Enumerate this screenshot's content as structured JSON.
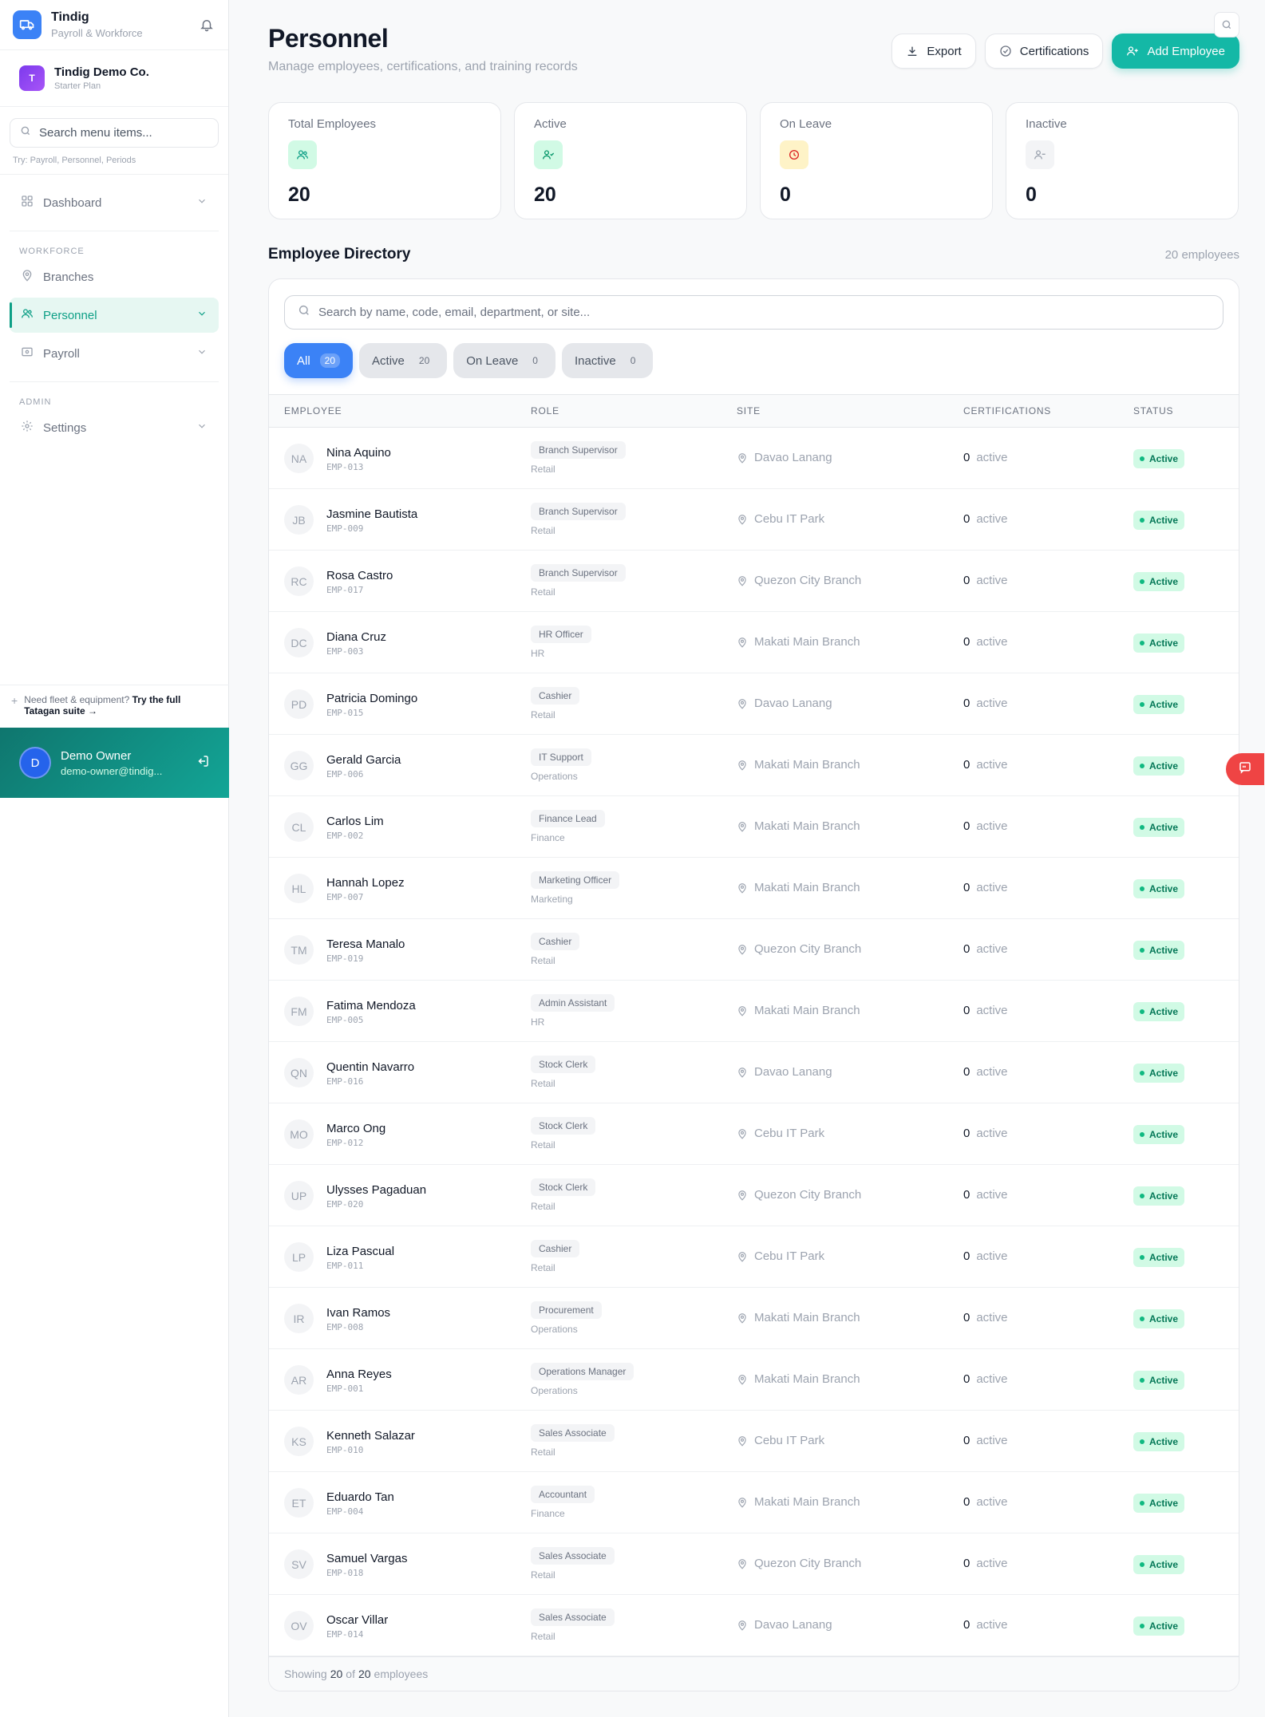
{
  "sidebar": {
    "brand_name": "Tindig",
    "brand_sub": "Payroll & Workforce",
    "org_initial": "T",
    "org_name": "Tindig Demo Co.",
    "org_plan": "Starter Plan",
    "search_placeholder": "Search menu items...",
    "search_hint": "Try: Payroll, Personnel, Periods",
    "dashboard": "Dashboard",
    "workforce_section": "WORKFORCE",
    "branches": "Branches",
    "personnel": "Personnel",
    "payroll": "Payroll",
    "admin_section": "ADMIN",
    "settings": "Settings",
    "promo_text": "Need fleet & equipment?",
    "promo_link": "Try the full Tatagan suite →",
    "user_initial": "D",
    "user_name": "Demo Owner",
    "user_email": "demo-owner@tindig..."
  },
  "header": {
    "title": "Personnel",
    "subtitle": "Manage employees, certifications, and training records",
    "export": "Export",
    "certifications": "Certifications",
    "add_employee": "Add Employee"
  },
  "stats": [
    {
      "label": "Total Employees",
      "value": "20"
    },
    {
      "label": "Active",
      "value": "20"
    },
    {
      "label": "On Leave",
      "value": "0"
    },
    {
      "label": "Inactive",
      "value": "0"
    }
  ],
  "directory": {
    "title": "Employee Directory",
    "count": "20 employees",
    "search_placeholder": "Search by name, code, email, department, or site...",
    "filters": [
      {
        "label": "All",
        "count": "20"
      },
      {
        "label": "Active",
        "count": "20"
      },
      {
        "label": "On Leave",
        "count": "0"
      },
      {
        "label": "Inactive",
        "count": "0"
      }
    ],
    "columns": {
      "employee": "EMPLOYEE",
      "role": "ROLE",
      "site": "SITE",
      "certifications": "CERTIFICATIONS",
      "status": "STATUS"
    },
    "cert_suffix": "active",
    "rows": [
      {
        "initials": "NA",
        "name": "Nina Aquino",
        "code": "EMP-013",
        "role": "Branch Supervisor",
        "dept": "Retail",
        "site": "Davao Lanang",
        "certs": "0",
        "status": "Active"
      },
      {
        "initials": "JB",
        "name": "Jasmine Bautista",
        "code": "EMP-009",
        "role": "Branch Supervisor",
        "dept": "Retail",
        "site": "Cebu IT Park",
        "certs": "0",
        "status": "Active"
      },
      {
        "initials": "RC",
        "name": "Rosa Castro",
        "code": "EMP-017",
        "role": "Branch Supervisor",
        "dept": "Retail",
        "site": "Quezon City Branch",
        "certs": "0",
        "status": "Active"
      },
      {
        "initials": "DC",
        "name": "Diana Cruz",
        "code": "EMP-003",
        "role": "HR Officer",
        "dept": "HR",
        "site": "Makati Main Branch",
        "certs": "0",
        "status": "Active"
      },
      {
        "initials": "PD",
        "name": "Patricia Domingo",
        "code": "EMP-015",
        "role": "Cashier",
        "dept": "Retail",
        "site": "Davao Lanang",
        "certs": "0",
        "status": "Active"
      },
      {
        "initials": "GG",
        "name": "Gerald Garcia",
        "code": "EMP-006",
        "role": "IT Support",
        "dept": "Operations",
        "site": "Makati Main Branch",
        "certs": "0",
        "status": "Active"
      },
      {
        "initials": "CL",
        "name": "Carlos Lim",
        "code": "EMP-002",
        "role": "Finance Lead",
        "dept": "Finance",
        "site": "Makati Main Branch",
        "certs": "0",
        "status": "Active"
      },
      {
        "initials": "HL",
        "name": "Hannah Lopez",
        "code": "EMP-007",
        "role": "Marketing Officer",
        "dept": "Marketing",
        "site": "Makati Main Branch",
        "certs": "0",
        "status": "Active"
      },
      {
        "initials": "TM",
        "name": "Teresa Manalo",
        "code": "EMP-019",
        "role": "Cashier",
        "dept": "Retail",
        "site": "Quezon City Branch",
        "certs": "0",
        "status": "Active"
      },
      {
        "initials": "FM",
        "name": "Fatima Mendoza",
        "code": "EMP-005",
        "role": "Admin Assistant",
        "dept": "HR",
        "site": "Makati Main Branch",
        "certs": "0",
        "status": "Active"
      },
      {
        "initials": "QN",
        "name": "Quentin Navarro",
        "code": "EMP-016",
        "role": "Stock Clerk",
        "dept": "Retail",
        "site": "Davao Lanang",
        "certs": "0",
        "status": "Active"
      },
      {
        "initials": "MO",
        "name": "Marco Ong",
        "code": "EMP-012",
        "role": "Stock Clerk",
        "dept": "Retail",
        "site": "Cebu IT Park",
        "certs": "0",
        "status": "Active"
      },
      {
        "initials": "UP",
        "name": "Ulysses Pagaduan",
        "code": "EMP-020",
        "role": "Stock Clerk",
        "dept": "Retail",
        "site": "Quezon City Branch",
        "certs": "0",
        "status": "Active"
      },
      {
        "initials": "LP",
        "name": "Liza Pascual",
        "code": "EMP-011",
        "role": "Cashier",
        "dept": "Retail",
        "site": "Cebu IT Park",
        "certs": "0",
        "status": "Active"
      },
      {
        "initials": "IR",
        "name": "Ivan Ramos",
        "code": "EMP-008",
        "role": "Procurement",
        "dept": "Operations",
        "site": "Makati Main Branch",
        "certs": "0",
        "status": "Active"
      },
      {
        "initials": "AR",
        "name": "Anna Reyes",
        "code": "EMP-001",
        "role": "Operations Manager",
        "dept": "Operations",
        "site": "Makati Main Branch",
        "certs": "0",
        "status": "Active"
      },
      {
        "initials": "KS",
        "name": "Kenneth Salazar",
        "code": "EMP-010",
        "role": "Sales Associate",
        "dept": "Retail",
        "site": "Cebu IT Park",
        "certs": "0",
        "status": "Active"
      },
      {
        "initials": "ET",
        "name": "Eduardo Tan",
        "code": "EMP-004",
        "role": "Accountant",
        "dept": "Finance",
        "site": "Makati Main Branch",
        "certs": "0",
        "status": "Active"
      },
      {
        "initials": "SV",
        "name": "Samuel Vargas",
        "code": "EMP-018",
        "role": "Sales Associate",
        "dept": "Retail",
        "site": "Quezon City Branch",
        "certs": "0",
        "status": "Active"
      },
      {
        "initials": "OV",
        "name": "Oscar Villar",
        "code": "EMP-014",
        "role": "Sales Associate",
        "dept": "Retail",
        "site": "Davao Lanang",
        "certs": "0",
        "status": "Active"
      }
    ],
    "footer": {
      "prefix": "Showing",
      "shown": "20",
      "of": "of",
      "total": "20",
      "suffix": "employees"
    }
  },
  "colors": {
    "accent": "#14b8a6",
    "primary_blue": "#3b82f6",
    "active_badge": "#d1fae5",
    "feedback": "#ef4444"
  }
}
